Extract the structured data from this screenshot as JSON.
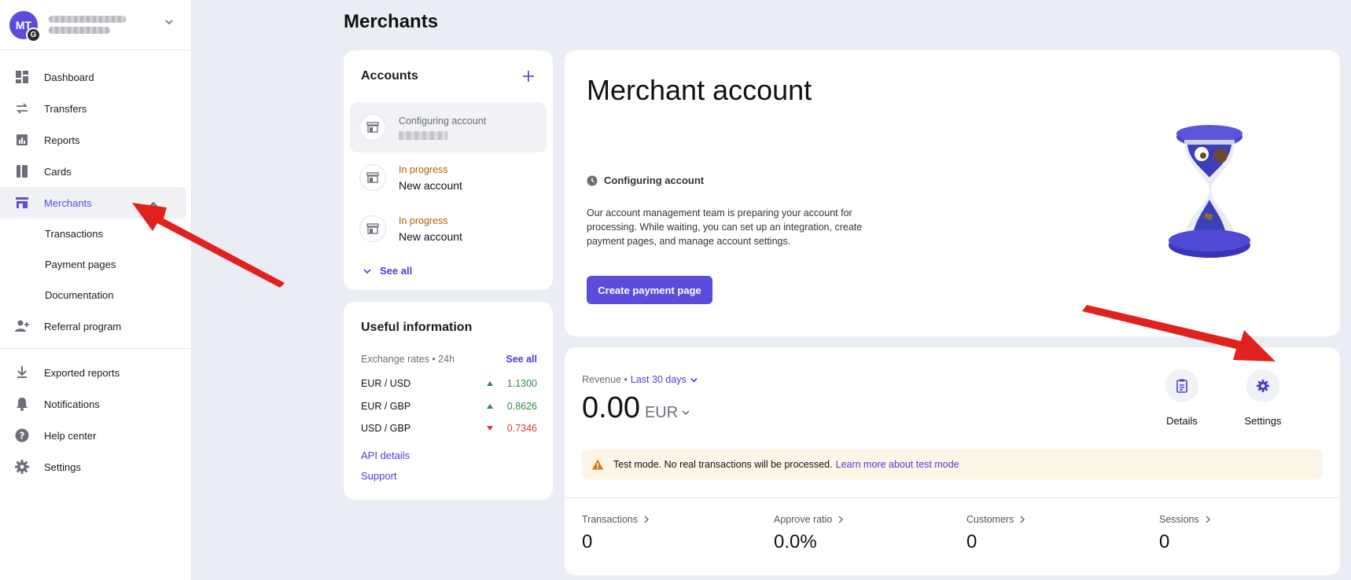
{
  "profile": {
    "initials": "MT",
    "sub_initial": "G"
  },
  "nav": {
    "items": [
      {
        "label": "Dashboard"
      },
      {
        "label": "Transfers"
      },
      {
        "label": "Reports"
      },
      {
        "label": "Cards"
      },
      {
        "label": "Merchants"
      }
    ],
    "sub_items": [
      {
        "label": "Transactions"
      },
      {
        "label": "Payment pages"
      },
      {
        "label": "Documentation"
      }
    ],
    "referral": "Referral program",
    "bottom": [
      {
        "label": "Exported reports"
      },
      {
        "label": "Notifications"
      },
      {
        "label": "Help center"
      },
      {
        "label": "Settings"
      }
    ]
  },
  "page": {
    "title": "Merchants"
  },
  "accounts": {
    "title": "Accounts",
    "items": [
      {
        "status": "Configuring account",
        "name": ""
      },
      {
        "status": "In progress",
        "name": "New account"
      },
      {
        "status": "In progress",
        "name": "New account"
      }
    ],
    "see_all": "See all"
  },
  "useful": {
    "title": "Useful information",
    "rates_label": "Exchange rates • 24h",
    "see_all": "See all",
    "rates": [
      {
        "pair": "EUR / USD",
        "value": "1.1300",
        "trend": "up"
      },
      {
        "pair": "EUR / GBP",
        "value": "0.8626",
        "trend": "up"
      },
      {
        "pair": "USD / GBP",
        "value": "0.7346",
        "trend": "down"
      }
    ],
    "api_details": "API details",
    "support": "Support"
  },
  "merchant": {
    "title": "Merchant account",
    "status": "Configuring account",
    "description": "Our account management team is preparing your account for processing. While waiting, you can set up an integration, create payment pages, and manage account settings.",
    "create_button": "Create payment page"
  },
  "revenue": {
    "label": "Revenue •",
    "period": "Last 30 days",
    "amount": "0.00",
    "currency": "EUR",
    "details": "Details",
    "settings": "Settings",
    "notice": "Test mode. No real transactions will be processed.",
    "notice_link": "Learn more about test mode",
    "stats": [
      {
        "title": "Transactions",
        "value": "0"
      },
      {
        "title": "Approve ratio",
        "value": "0.0%"
      },
      {
        "title": "Customers",
        "value": "0"
      },
      {
        "title": "Sessions",
        "value": "0"
      }
    ]
  },
  "colors": {
    "accent": "#5b4cdb",
    "arrow": "#e0211e",
    "positive": "#2e8b46",
    "negative": "#d23a3a"
  }
}
